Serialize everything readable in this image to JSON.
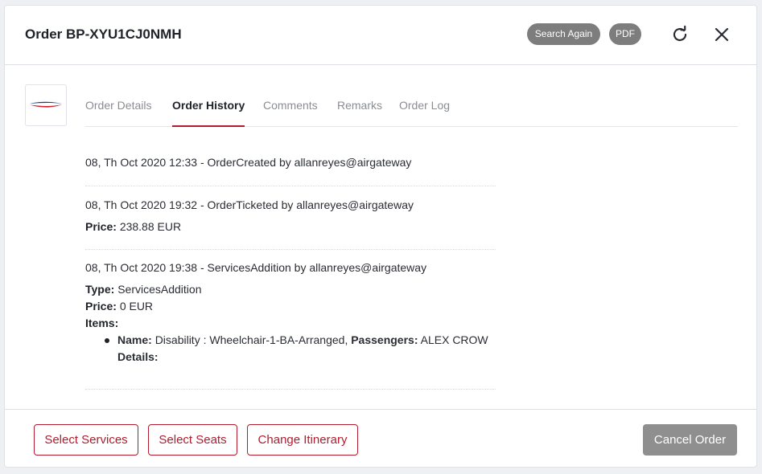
{
  "header": {
    "title": "Order BP-XYU1CJ0NMH",
    "search_again_label": "Search Again",
    "pdf_label": "PDF",
    "refresh_icon": "refresh-icon",
    "close_icon": "close-icon"
  },
  "airline_logo": {
    "icon": "british-airways-speedmarque-logo",
    "colors": [
      "#d0202e",
      "#1e3c8c"
    ]
  },
  "tabs": [
    {
      "label": "Order Details",
      "active": false
    },
    {
      "label": "Order History",
      "active": true
    },
    {
      "label": "Comments",
      "active": false
    },
    {
      "label": "Remarks",
      "active": false
    },
    {
      "label": "Order Log",
      "active": false
    }
  ],
  "history": [
    {
      "line": "08, Th Oct 2020 12:33 - OrderCreated by allanreyes@airgateway"
    },
    {
      "line": "08, Th Oct 2020 19:32 - OrderTicketed by allanreyes@airgateway",
      "price_label": "Price:",
      "price_value": "238.88 EUR"
    },
    {
      "line": "08, Th Oct 2020 19:38 - ServicesAddition by allanreyes@airgateway",
      "type_label": "Type:",
      "type_value": "ServicesAddition",
      "price_label": "Price:",
      "price_value": "0 EUR",
      "items_label": "Items:",
      "items": [
        {
          "name_label": "Name:",
          "name_value": "Disability : Wheelchair-1-BA-Arranged,",
          "passengers_label": "Passengers:",
          "passengers_value": "ALEX CROW",
          "details_label": "Details:"
        }
      ]
    }
  ],
  "footer": {
    "select_services": "Select Services",
    "select_seats": "Select Seats",
    "change_itinerary": "Change Itinerary",
    "cancel_order": "Cancel Order"
  },
  "colors": {
    "accent": "#b01c2e",
    "pill": "#7d7d7d",
    "cancel": "#8f8f8f"
  }
}
